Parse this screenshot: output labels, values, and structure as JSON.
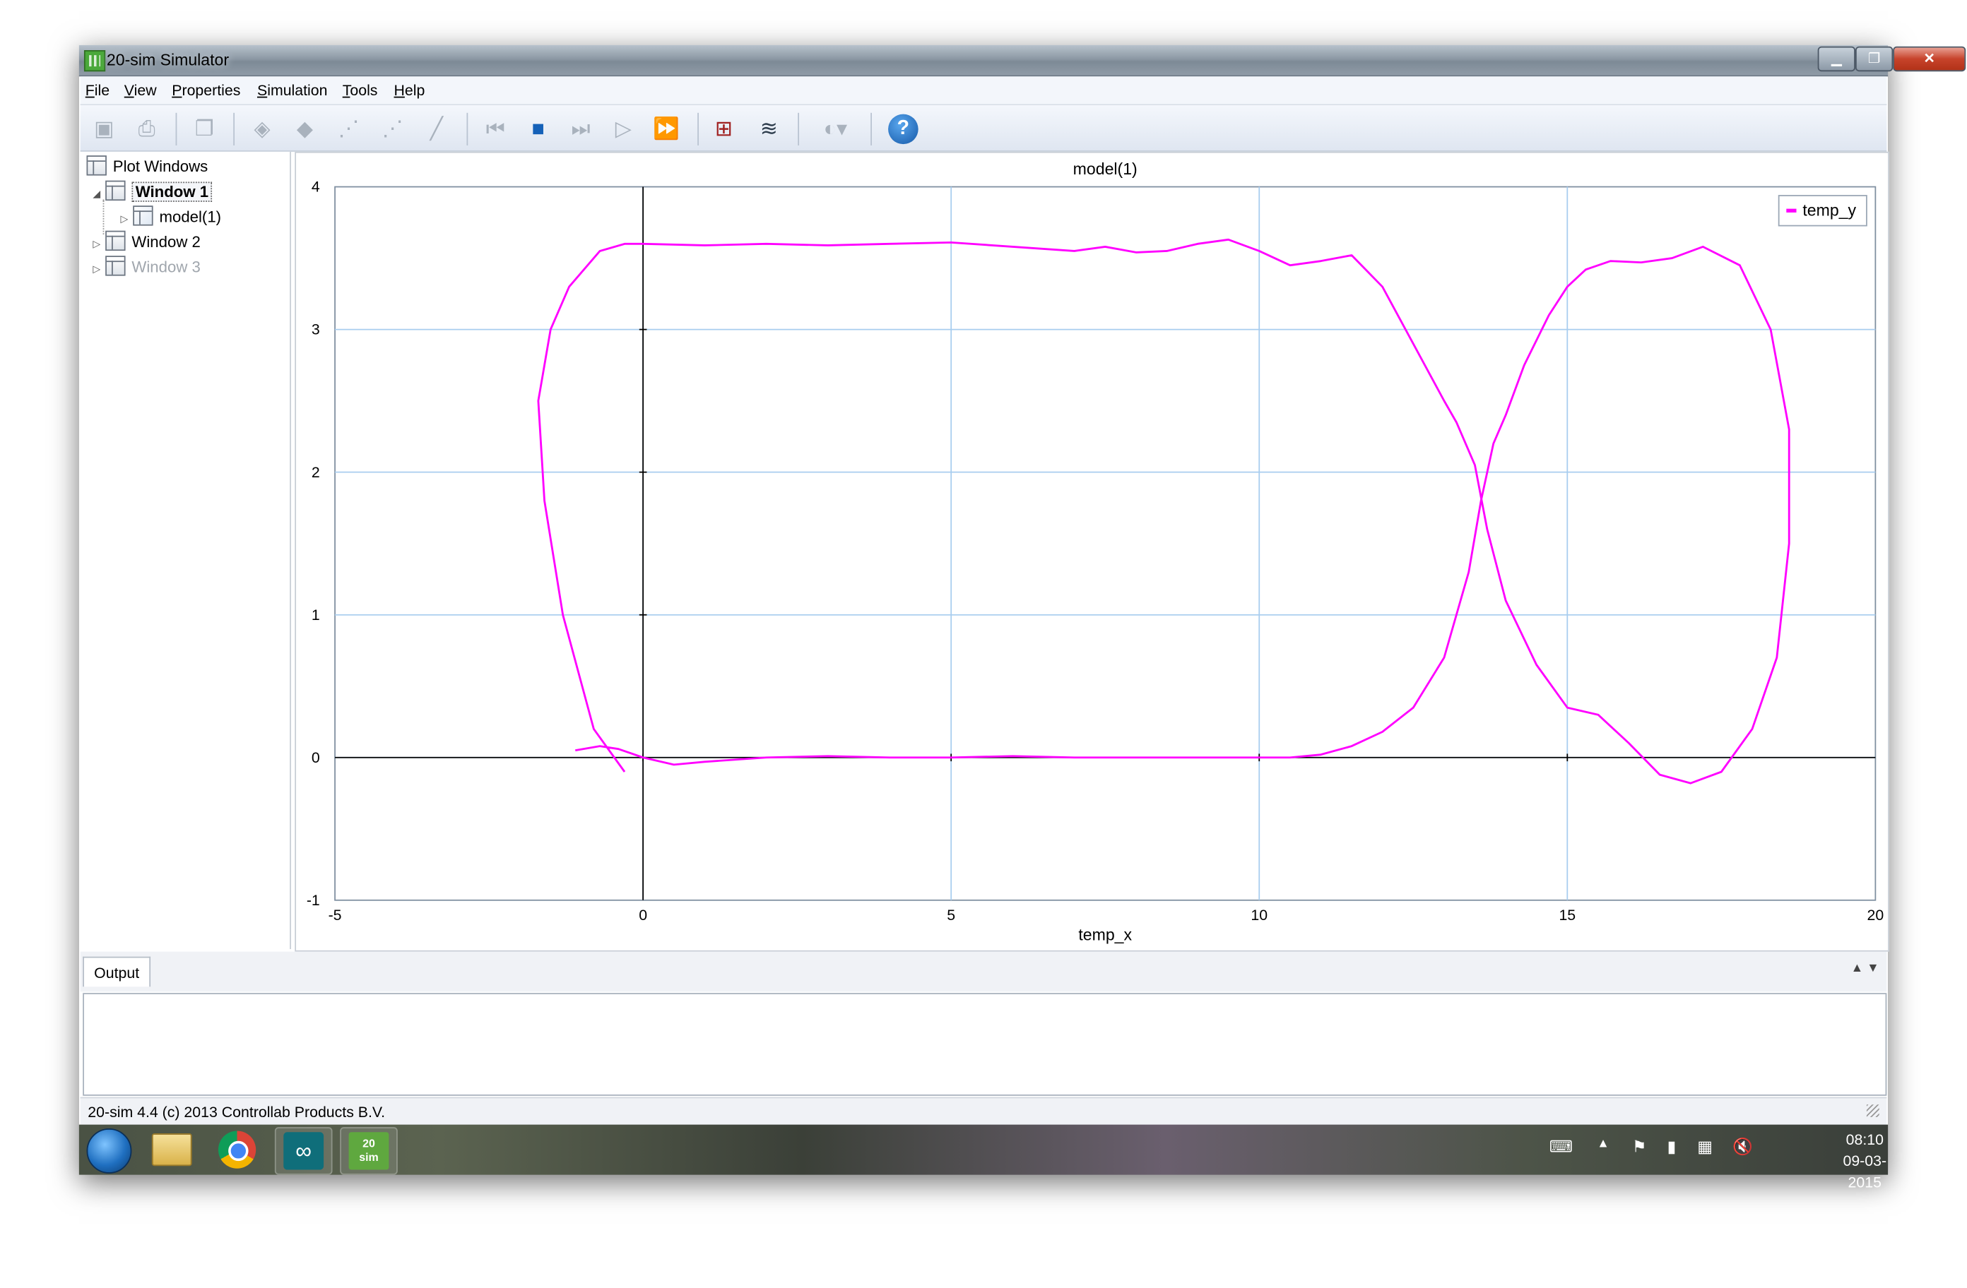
{
  "window": {
    "title": "20-sim Simulator"
  },
  "menu": [
    {
      "label": "File",
      "u": "F",
      "rest": "ile"
    },
    {
      "label": "View",
      "u": "V",
      "rest": "iew"
    },
    {
      "label": "Properties",
      "u": "P",
      "rest": "roperties"
    },
    {
      "label": "Simulation",
      "u": "S",
      "rest": "imulation"
    },
    {
      "label": "Tools",
      "u": "T",
      "rest": "ools"
    },
    {
      "label": "Help",
      "u": "H",
      "rest": "elp"
    }
  ],
  "toolbar_icons": [
    "save-icon",
    "print-icon",
    "copy-icon",
    "parameters-icon",
    "eraser-icon",
    "step-back-icon",
    "step-forward-icon",
    "edit-icon",
    "go-to-start-icon",
    "stop-icon",
    "step-icon",
    "run-icon",
    "fast-forward-icon",
    "plot-properties-icon",
    "plot-windows-icon",
    "animation-icon",
    "help-icon"
  ],
  "tree": {
    "root": "Plot Windows",
    "items": [
      {
        "label": "Window 1",
        "selected": true
      },
      {
        "label": "model(1)"
      },
      {
        "label": "Window 2"
      },
      {
        "label": "Window 3",
        "disabled": true
      }
    ]
  },
  "chart_data": {
    "type": "line",
    "title": "model(1)",
    "xlabel": "temp_x",
    "ylabel": "",
    "xlim": [
      -5,
      20
    ],
    "ylim": [
      -1,
      4
    ],
    "xticks": [
      "-5",
      "0",
      "5",
      "10",
      "15",
      "20"
    ],
    "yticks": [
      "-1",
      "0",
      "1",
      "2",
      "3",
      "4"
    ],
    "grid": true,
    "legend": "top-right",
    "series": [
      {
        "name": "temp_y",
        "color": "#ff00ff",
        "x": [
          -0.3,
          -0.8,
          -1.3,
          -1.6,
          -1.7,
          -1.5,
          -1.2,
          -0.7,
          -0.3,
          0,
          1,
          2,
          3,
          4,
          5,
          6,
          7,
          7.5,
          8,
          8.5,
          9,
          9.5,
          10,
          10.5,
          11,
          11.5,
          12,
          12.5,
          13,
          13.2,
          13.5,
          13.7,
          14,
          14.5,
          15,
          15.5,
          16,
          16.5,
          17,
          17.5,
          18,
          18.4,
          18.6,
          18.6,
          18.3,
          17.8,
          17.2,
          16.7,
          16.2,
          15.7,
          15.3,
          15.0,
          14.7,
          14.3,
          14.0,
          13.8,
          13.6,
          13.4,
          13.0,
          12.5,
          12.0,
          11.5,
          11.0,
          10.5,
          10.0,
          9,
          8,
          7,
          6,
          5,
          4,
          3,
          2,
          1,
          0.5,
          0,
          -0.4,
          -0.7,
          -1.1
        ],
        "y": [
          -0.1,
          0.2,
          1.0,
          1.8,
          2.5,
          3.0,
          3.3,
          3.55,
          3.6,
          3.6,
          3.59,
          3.6,
          3.59,
          3.6,
          3.61,
          3.58,
          3.55,
          3.58,
          3.54,
          3.55,
          3.6,
          3.63,
          3.55,
          3.45,
          3.48,
          3.52,
          3.3,
          2.9,
          2.5,
          2.35,
          2.05,
          1.6,
          1.1,
          0.65,
          0.35,
          0.3,
          0.1,
          -0.12,
          -0.18,
          -0.1,
          0.2,
          0.7,
          1.5,
          2.3,
          3.0,
          3.45,
          3.58,
          3.5,
          3.47,
          3.48,
          3.42,
          3.3,
          3.1,
          2.75,
          2.4,
          2.2,
          1.8,
          1.3,
          0.7,
          0.35,
          0.18,
          0.08,
          0.02,
          0.0,
          0.0,
          0.0,
          0.0,
          0.0,
          0.01,
          0.0,
          0.0,
          0.01,
          0.0,
          -0.03,
          -0.05,
          0.0,
          0.06,
          0.08,
          0.05
        ]
      }
    ]
  },
  "output": {
    "tab_label": "Output",
    "scroll_up": "▲",
    "scroll_down": "▼"
  },
  "status": {
    "text": "20-sim 4.4 (c) 2013 Controllab Products B.V."
  },
  "taskbar": {
    "buttons": [
      "start-orb-icon",
      "file-explorer-icon",
      "chrome-icon",
      "arduino-icon",
      "20-sim-icon"
    ],
    "app_20sim_label": "20\nsim",
    "time": "08:10",
    "date": "09-03-2015"
  }
}
